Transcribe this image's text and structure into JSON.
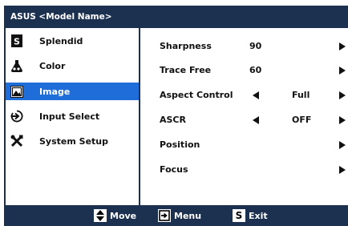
{
  "title": "ASUS <Model Name>",
  "sidebar": {
    "items": [
      {
        "label": "Splendid",
        "icon": "splendid-s-icon",
        "selected": false
      },
      {
        "label": "Color",
        "icon": "color-flask-icon",
        "selected": false
      },
      {
        "label": "Image",
        "icon": "image-picture-icon",
        "selected": true
      },
      {
        "label": "Input Select",
        "icon": "input-select-icon",
        "selected": false
      },
      {
        "label": "System Setup",
        "icon": "system-setup-tools-icon",
        "selected": false
      }
    ]
  },
  "content": {
    "rows": [
      {
        "label": "Sharpness",
        "value": "90"
      },
      {
        "label": "Trace Free",
        "value": "60"
      },
      {
        "label": "Aspect Control",
        "value": "Full"
      },
      {
        "label": "ASCR",
        "value": "OFF"
      },
      {
        "label": "Position",
        "value": ""
      },
      {
        "label": "Focus",
        "value": ""
      }
    ]
  },
  "footer": {
    "move_label": "Move",
    "menu_label": "Menu",
    "exit_label": "Exit",
    "exit_icon_letter": "S"
  },
  "colors": {
    "bar": "#1c3150",
    "selected": "#1e6dd8",
    "background": "#ffffff"
  }
}
